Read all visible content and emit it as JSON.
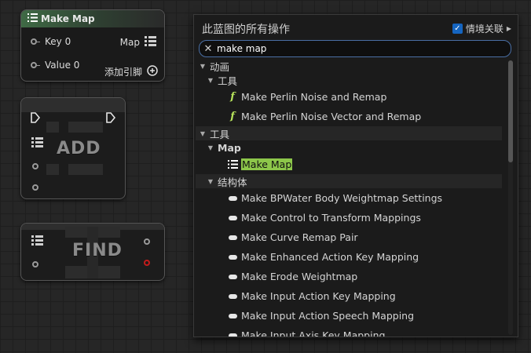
{
  "make_map_node": {
    "title": "Make Map",
    "pins": {
      "key": "Key 0",
      "value": "Value 0",
      "output": "Map",
      "add_pin": "添加引脚"
    }
  },
  "add_node": {
    "label": "ADD"
  },
  "find_node": {
    "label": "FIND"
  },
  "panel": {
    "title": "此蓝图的所有操作",
    "context_label": "情境关联",
    "context_checked": true,
    "search_value": "make map",
    "categories": [
      {
        "label": "动画"
      },
      {
        "label": "工具"
      },
      {
        "label": "工具"
      },
      {
        "label": "Map"
      },
      {
        "label": "结构体"
      }
    ],
    "anim_items": [
      "Make Perlin Noise and Remap",
      "Make Perlin Noise Vector and Remap"
    ],
    "map_item": "Make Map",
    "struct_items": [
      "Make BPWater Body Weightmap Settings",
      "Make Control to Transform Mappings",
      "Make Curve Remap Pair",
      "Make Enhanced Action Key Mapping",
      "Make Erode Weightmap",
      "Make Input Action Key Mapping",
      "Make Input Action Speech Mapping",
      "Make Input Axis Key Mapping"
    ]
  },
  "colors": {
    "accent_blue": "#1565c0",
    "highlight_green": "#8dc74a",
    "function_icon": "#b7e35b",
    "node_header": "#3f6a45",
    "exec_pin_red": "#c21b1b"
  },
  "icons": {
    "function": "function-icon",
    "structure": "struct-icon",
    "map_grid": "map-grid-icon",
    "clear": "close-icon",
    "add_pin": "plus-circle-icon"
  }
}
